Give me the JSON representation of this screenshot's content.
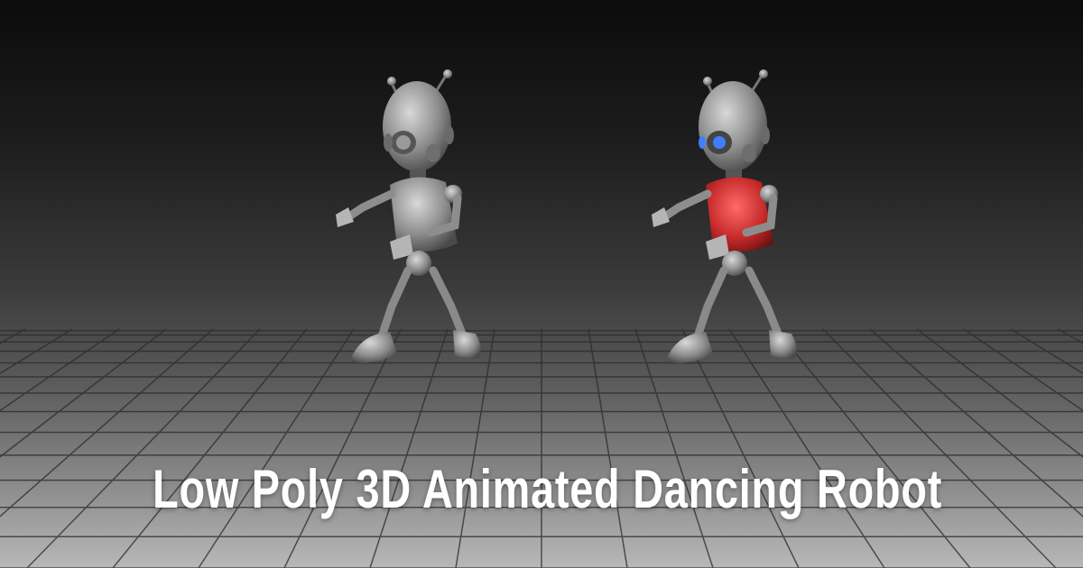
{
  "title": "Low Poly 3D Animated Dancing Robot",
  "colors": {
    "robot_metal": "#9a9a9a",
    "robot_metal_dark": "#4a4a4a",
    "vest_variant_color": "#c62a2a",
    "eye_glow_color": "#3f7fff",
    "title_text": "#ffffff"
  },
  "scene": {
    "floor": "perspective-grid",
    "background": "dark-to-light-gray-gradient",
    "robots": [
      {
        "variant": "gray",
        "eye": "gray",
        "vest": "gray"
      },
      {
        "variant": "red-vest",
        "eye": "blue",
        "vest": "red"
      }
    ]
  }
}
